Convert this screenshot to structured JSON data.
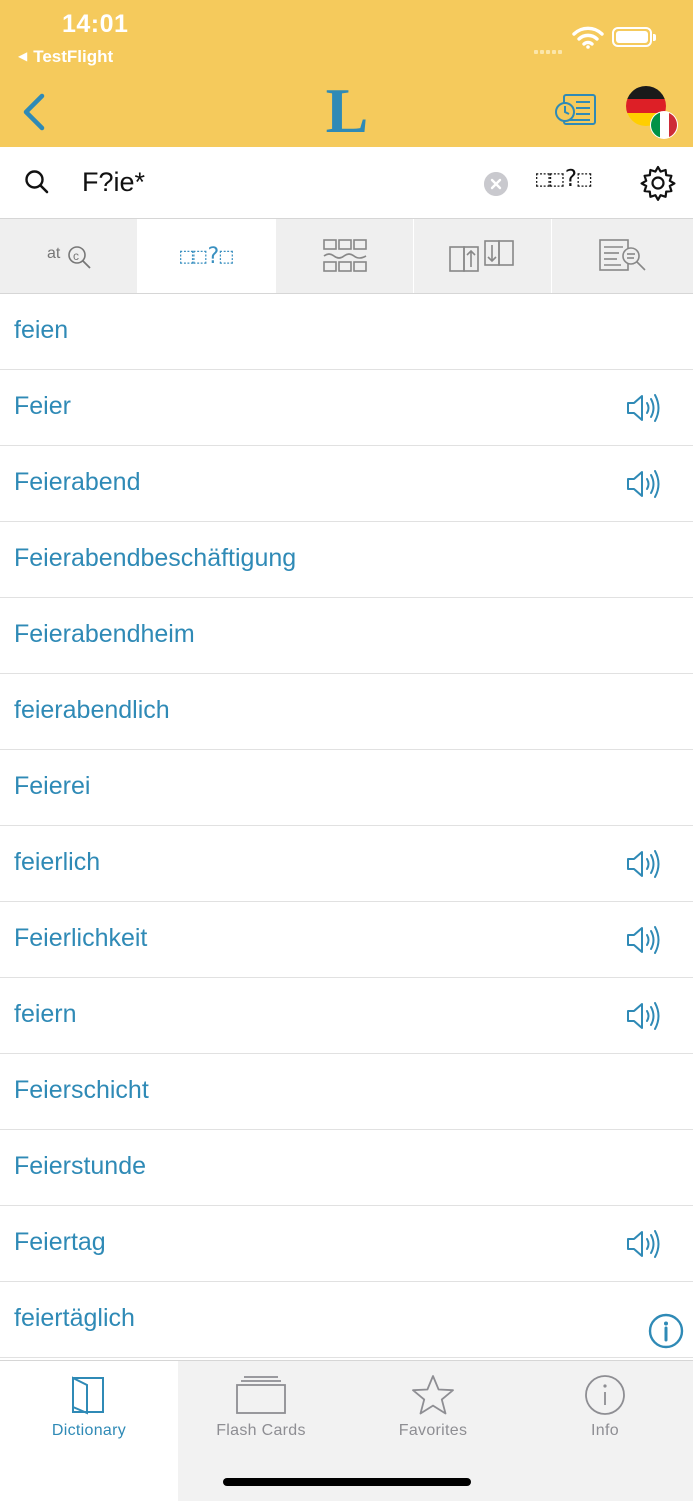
{
  "status_bar": {
    "time": "14:01",
    "back_app": "TestFlight"
  },
  "nav": {
    "logo_letter": "L"
  },
  "search": {
    "query": "F?ie*",
    "wildcard_label": "⬚⬚?⬚"
  },
  "mode_tabs": [
    {
      "glyph": "at🔍",
      "icon": "spellcheck-search-icon",
      "active": false
    },
    {
      "glyph": "⬚⬚?⬚",
      "icon": "wildcard-search-icon",
      "active": true
    },
    {
      "glyph": "",
      "icon": "phrase-grid-icon",
      "active": false
    },
    {
      "glyph": "",
      "icon": "inflection-table-icon",
      "active": false
    },
    {
      "glyph": "",
      "icon": "fulltext-search-icon",
      "active": false
    }
  ],
  "results": [
    {
      "word": "feien",
      "audio": false
    },
    {
      "word": "Feier",
      "audio": true
    },
    {
      "word": "Feierabend",
      "audio": true
    },
    {
      "word": "Feierabendbeschäftigung",
      "audio": false
    },
    {
      "word": "Feierabendheim",
      "audio": false
    },
    {
      "word": "feierabendlich",
      "audio": false
    },
    {
      "word": "Feierei",
      "audio": false
    },
    {
      "word": "feierlich",
      "audio": true
    },
    {
      "word": "Feierlichkeit",
      "audio": true
    },
    {
      "word": "feiern",
      "audio": true
    },
    {
      "word": "Feierschicht",
      "audio": false
    },
    {
      "word": "Feierstunde",
      "audio": false
    },
    {
      "word": "Feiertag",
      "audio": true
    },
    {
      "word": "feiertäglich",
      "audio": false
    }
  ],
  "tab_bar": {
    "items": [
      {
        "label": "Dictionary",
        "icon": "book-icon",
        "active": true
      },
      {
        "label": "Flash Cards",
        "icon": "flashcards-icon",
        "active": false
      },
      {
        "label": "Favorites",
        "icon": "star-icon",
        "active": false
      },
      {
        "label": "Info",
        "icon": "info-icon",
        "active": false
      }
    ]
  },
  "colors": {
    "header_bg": "#f5ca5c",
    "accent": "#2f8ab6",
    "tab_inactive": "#8e8e93"
  }
}
